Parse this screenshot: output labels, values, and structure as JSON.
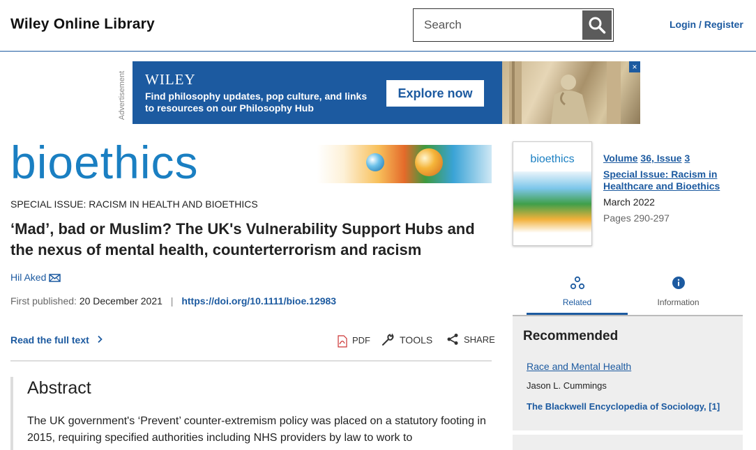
{
  "header": {
    "brand": "Wiley Online Library",
    "search_placeholder": "Search",
    "login": "Login / Register"
  },
  "ad": {
    "label": "Advertisement",
    "logo": "WILEY",
    "text": "Find philosophy updates, pop culture, and links to resources on our Philosophy Hub",
    "button": "Explore now",
    "close": "×"
  },
  "journal": {
    "title": "bioethics"
  },
  "article": {
    "special_issue": "SPECIAL ISSUE: RACISM IN HEALTH AND BIOETHICS",
    "title": "‘Mad’, bad or Muslim? The UK's Vulnerability Support Hubs and the nexus of mental health, counterterrorism and racism",
    "author": "Hil Aked",
    "first_published_label": "First published:",
    "first_published_date": "20 December 2021",
    "separator": "|",
    "doi": "https://doi.org/10.1111/bioe.12983",
    "read_full": "Read the full text",
    "tools": {
      "pdf": "PDF",
      "tools": "TOOLS",
      "share": "SHARE"
    },
    "abstract_heading": "Abstract",
    "abstract_text": "The UK government's ‘Prevent’ counter-extremism policy was placed on a statutory footing in 2015, requiring specified authorities including NHS providers by law to work to"
  },
  "issue": {
    "cover_title": "bioethics",
    "volume": "Volume",
    "volume_issue": "36, Issue",
    "issue_number": "3",
    "special_issue": "Special Issue: Racism in Healthcare and Bioethics",
    "date": "March 2022",
    "pages": "Pages 290-297"
  },
  "tabs": {
    "related": "Related",
    "information": "Information"
  },
  "recommended": {
    "heading": "Recommended",
    "items": [
      {
        "title": "Race and Mental Health",
        "author": "Jason L. Cummings",
        "source": "The Blackwell Encyclopedia of Sociology, [1]"
      }
    ]
  },
  "colors": {
    "link": "#1c5aa0",
    "journal_blue": "#1a7fc2",
    "panel_bg": "#eeeeee"
  }
}
